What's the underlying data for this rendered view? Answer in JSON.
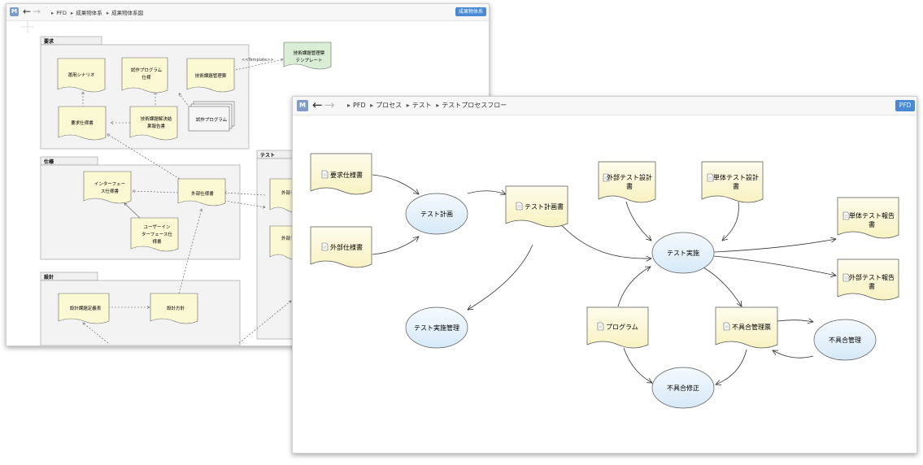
{
  "back_window": {
    "app_icon": "M",
    "breadcrumb": [
      "PFD",
      "成果物体系",
      "成果物体系図"
    ],
    "tag": "成果物体系",
    "packages": {
      "requirements": "要求",
      "spec": "仕様",
      "design": "設計",
      "test": "テスト"
    },
    "docs": {
      "ops_scenario": "運用シナリオ",
      "proto_spec": [
        "試作プログラム",
        "仕様"
      ],
      "tech_issue_table": "技術課題管理票",
      "req_spec": "要求仕様書",
      "tech_issue_report": [
        "技術課題解決結",
        "果報告書"
      ],
      "proto_program": "試作プログラム",
      "template": [
        "技術課題管理票",
        "テンプレート"
      ],
      "interface_spec": [
        "インターフェー",
        "ス仕様書"
      ],
      "external_spec": "外部仕様書",
      "ui_spec": [
        "ユーザーイン",
        "ターフェース仕",
        "様書"
      ],
      "design_issue_table": "設計課題定義表",
      "design_policy": "設計方針",
      "partial_a": "外部テ",
      "partial_b": "外部テ"
    },
    "stereotype": "<<Template>>"
  },
  "front_window": {
    "app_icon": "M",
    "breadcrumb": [
      "PFD",
      "プロセス",
      "テスト",
      "テストプロセスフロー"
    ],
    "tag": "PFD",
    "docs": {
      "req_spec": "要求仕様書",
      "ext_spec": "外部仕様書",
      "test_plan": "テスト計画書",
      "ext_test_design": [
        "外部テスト設計",
        "書"
      ],
      "unit_test_design": [
        "単体テスト設計",
        "書"
      ],
      "unit_test_report": [
        "単体テスト報告",
        "書"
      ],
      "ext_test_report": [
        "外部テスト報告",
        "書"
      ],
      "program": "プログラム",
      "defect_table": "不具合管理票"
    },
    "processes": {
      "test_planning": "テスト計画",
      "test_execution": "テスト実施",
      "test_exec_mgmt": "テスト実施管理",
      "defect_mgmt": "不具合管理",
      "defect_fix": "不具合修正"
    }
  }
}
